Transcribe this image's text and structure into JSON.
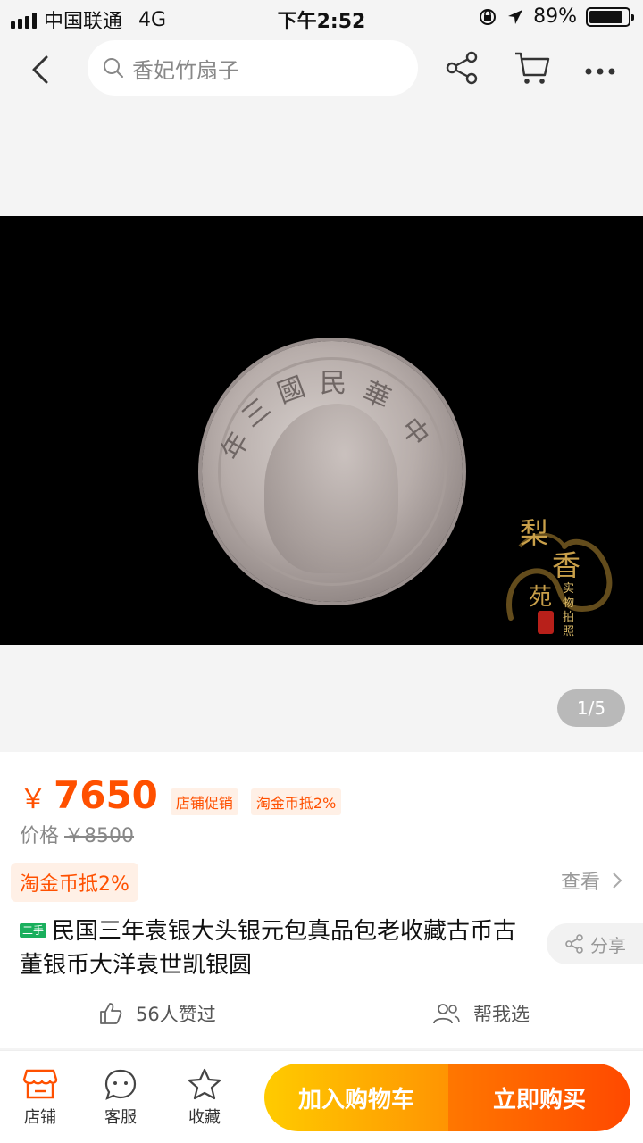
{
  "status_bar": {
    "carrier": "中国联通",
    "network": "4G",
    "time": "下午2:52",
    "battery_percent": "89%",
    "battery_level": 0.89
  },
  "nav": {
    "search_placeholder": "香妃竹扇子",
    "icons": [
      "back-icon",
      "share-icon",
      "cart-icon",
      "more-icon"
    ]
  },
  "gallery": {
    "coin_chars": [
      "中",
      "華",
      "民",
      "國",
      "三",
      "年"
    ],
    "watermark": {
      "chars": [
        "梨",
        "香",
        "苑"
      ],
      "small_1": "实物",
      "small_2": "拍照"
    },
    "counter": "1/5"
  },
  "product": {
    "currency": "￥",
    "price": "7650",
    "tags": [
      "店铺促销",
      "淘金币抵2%"
    ],
    "orig_label": "价格",
    "orig_price": "￥8500",
    "coin_badge": "淘金币抵2%",
    "view_label": "查看",
    "badge": "二手",
    "title": "民国三年袁银大头银元包真品包老收藏古币古董银币大洋袁世凯银圆",
    "share_label": "分享",
    "likes_label": "56人赞过",
    "help_label": "帮我选"
  },
  "bottom_bar": {
    "shop": "店铺",
    "service": "客服",
    "favorite": "收藏",
    "add_cart": "加入购物车",
    "buy_now": "立即购买"
  },
  "colors": {
    "accent": "#ff5000",
    "cart_btn": "#ffcb00",
    "buy_btn": "#ff4900"
  }
}
